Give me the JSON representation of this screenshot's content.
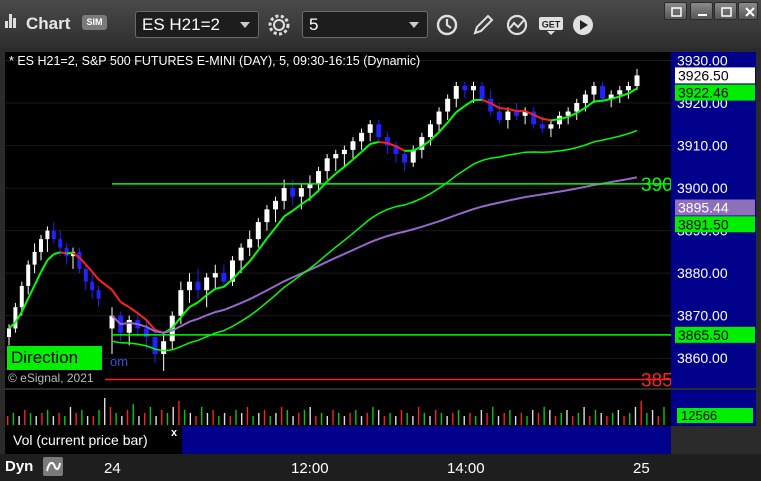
{
  "toolbar": {
    "title": "Chart",
    "sim_badge": "SIM",
    "symbol": "ES H21=2",
    "interval": "5"
  },
  "chart_header": "* ES H21=2, S&P 500 FUTURES E-MINI (DAY), 5, 09:30-16:15 (Dynamic)",
  "annotations": {
    "direction": "Direction",
    "esignal": "© eSignal, 2021",
    "com_fragment": "om",
    "line_3900_label": "390",
    "line_3855_label": "385"
  },
  "volume_panel": {
    "label": "Vol (current price bar)",
    "close": "x",
    "current_value": "12566"
  },
  "time_axis": {
    "dyn_label": "Dyn",
    "ticks": [
      "24",
      "12:00",
      "14:00",
      "25"
    ]
  },
  "colors": {
    "up_candle": "#ffffff",
    "down_candle": "#2222ff",
    "fast_ma": "#00ff00",
    "ma_red": "#ff2020",
    "slow_ma": "#9966cc",
    "level_green": "#00ff00",
    "level_red": "#ff2020",
    "axis_bg": "#00008b"
  },
  "chart_data": {
    "type": "candlestick",
    "title": "* ES H21=2, S&P 500 FUTURES E-MINI (DAY), 5, 09:30-16:15 (Dynamic)",
    "ylim": [
      3853,
      3932
    ],
    "y_ticks": [
      3860,
      3870,
      3880,
      3890,
      3900,
      3910,
      3920,
      3930
    ],
    "y_tick_labels": [
      "3860.00",
      "3870.00",
      "3880.00",
      "3890.00",
      "3900.00",
      "3910.00",
      "3920.00",
      "3930.00"
    ],
    "x_ticks": [
      "24",
      "12:00",
      "14:00",
      "25"
    ],
    "price_badges": [
      {
        "value": 3926.5,
        "label": "3926.50",
        "bg": "#ffffff",
        "fg": "#000000"
      },
      {
        "value": 3922.46,
        "label": "3922.46",
        "bg": "#00ee00",
        "fg": "#000000"
      },
      {
        "value": 3895.44,
        "label": "3895.44",
        "bg": "#8f6fb8",
        "fg": "#ffffff"
      },
      {
        "value": 3891.5,
        "label": "3891.50",
        "bg": "#00ee00",
        "fg": "#000000"
      },
      {
        "value": 3865.5,
        "label": "3865.50",
        "bg": "#00ee00",
        "fg": "#000000"
      }
    ],
    "levels": [
      {
        "value": 3901,
        "color": "#00ff00",
        "label": "390"
      },
      {
        "value": 3865.5,
        "color": "#00ff00",
        "label": ""
      },
      {
        "value": 3855,
        "color": "#ff2020",
        "label": "385"
      }
    ],
    "candles_prior_session": [
      [
        3865,
        3868,
        3863,
        3867
      ],
      [
        3867,
        3873,
        3866,
        3872
      ],
      [
        3872,
        3878,
        3870,
        3877
      ],
      [
        3877,
        3883,
        3875,
        3882
      ],
      [
        3882,
        3887,
        3880,
        3885
      ],
      [
        3885,
        3889,
        3883,
        3888
      ],
      [
        3888,
        3891,
        3885,
        3890
      ],
      [
        3890,
        3892,
        3887,
        3888
      ],
      [
        3888,
        3890,
        3884,
        3886
      ],
      [
        3886,
        3887,
        3882,
        3884
      ],
      [
        3884,
        3886,
        3881,
        3885
      ],
      [
        3885,
        3886,
        3880,
        3881
      ],
      [
        3881,
        3882,
        3876,
        3878
      ],
      [
        3878,
        3880,
        3874,
        3876
      ],
      [
        3876,
        3877,
        3872,
        3874
      ]
    ],
    "candles": [
      [
        3867,
        3872,
        3861,
        3870
      ],
      [
        3870,
        3871,
        3864,
        3866
      ],
      [
        3866,
        3870,
        3863,
        3869
      ],
      [
        3869,
        3871,
        3865,
        3867
      ],
      [
        3867,
        3869,
        3862,
        3865
      ],
      [
        3865,
        3867,
        3859,
        3861
      ],
      [
        3861,
        3866,
        3857,
        3864
      ],
      [
        3864,
        3871,
        3862,
        3870
      ],
      [
        3870,
        3878,
        3868,
        3876
      ],
      [
        3876,
        3880,
        3873,
        3878
      ],
      [
        3878,
        3881,
        3874,
        3876
      ],
      [
        3876,
        3880,
        3872,
        3879
      ],
      [
        3879,
        3882,
        3876,
        3880
      ],
      [
        3880,
        3882,
        3877,
        3878
      ],
      [
        3878,
        3884,
        3877,
        3883
      ],
      [
        3883,
        3887,
        3880,
        3886
      ],
      [
        3886,
        3890,
        3884,
        3888
      ],
      [
        3888,
        3893,
        3886,
        3892
      ],
      [
        3892,
        3896,
        3890,
        3895
      ],
      [
        3895,
        3898,
        3892,
        3897
      ],
      [
        3897,
        3902,
        3895,
        3900
      ],
      [
        3900,
        3902,
        3896,
        3898
      ],
      [
        3898,
        3901,
        3895,
        3900
      ],
      [
        3900,
        3903,
        3897,
        3901
      ],
      [
        3901,
        3905,
        3899,
        3904
      ],
      [
        3904,
        3908,
        3902,
        3907
      ],
      [
        3907,
        3909,
        3904,
        3908
      ],
      [
        3908,
        3910,
        3905,
        3909
      ],
      [
        3909,
        3912,
        3907,
        3911
      ],
      [
        3911,
        3914,
        3909,
        3913
      ],
      [
        3913,
        3916,
        3911,
        3915
      ],
      [
        3915,
        3916,
        3911,
        3912
      ],
      [
        3912,
        3913,
        3908,
        3910
      ],
      [
        3910,
        3911,
        3906,
        3908
      ],
      [
        3908,
        3909,
        3904,
        3906
      ],
      [
        3906,
        3910,
        3905,
        3909
      ],
      [
        3909,
        3913,
        3907,
        3912
      ],
      [
        3912,
        3916,
        3910,
        3915
      ],
      [
        3915,
        3919,
        3913,
        3918
      ],
      [
        3918,
        3922,
        3916,
        3921
      ],
      [
        3921,
        3925,
        3919,
        3924
      ],
      [
        3924,
        3925,
        3921,
        3923
      ],
      [
        3923,
        3925,
        3920,
        3924
      ],
      [
        3924,
        3925,
        3920,
        3921
      ],
      [
        3921,
        3923,
        3917,
        3918
      ],
      [
        3918,
        3920,
        3915,
        3916
      ],
      [
        3916,
        3919,
        3914,
        3918
      ],
      [
        3918,
        3920,
        3916,
        3917
      ],
      [
        3917,
        3919,
        3915,
        3918
      ],
      [
        3918,
        3919,
        3914,
        3915
      ],
      [
        3915,
        3917,
        3913,
        3914
      ],
      [
        3914,
        3916,
        3912,
        3915
      ],
      [
        3915,
        3918,
        3914,
        3917
      ],
      [
        3917,
        3919,
        3915,
        3918
      ],
      [
        3918,
        3921,
        3916,
        3920
      ],
      [
        3920,
        3923,
        3918,
        3922
      ],
      [
        3922,
        3925,
        3920,
        3924
      ],
      [
        3924,
        3925,
        3920,
        3921
      ],
      [
        3921,
        3923,
        3919,
        3922
      ],
      [
        3922,
        3924,
        3920,
        3923
      ],
      [
        3923,
        3925,
        3921,
        3924
      ],
      [
        3924,
        3928,
        3923,
        3926.5
      ]
    ],
    "volume": [
      3,
      4,
      3,
      5,
      4,
      3,
      4,
      5,
      3,
      4,
      3,
      6,
      4,
      5,
      3,
      3,
      5,
      9,
      6,
      4,
      3,
      5,
      7,
      3,
      4,
      6,
      3,
      5,
      4,
      6,
      8,
      5,
      4,
      3,
      6,
      4,
      5,
      3,
      4,
      3,
      5,
      4,
      6,
      3,
      4,
      5,
      3,
      4,
      6,
      5,
      3,
      4,
      5,
      6,
      3,
      4,
      3,
      5,
      4,
      3,
      4,
      5,
      3,
      4,
      6,
      5,
      3,
      4,
      3,
      5,
      4,
      3,
      6,
      4,
      3,
      5,
      4,
      3,
      4,
      5,
      3,
      4,
      3,
      5,
      4,
      6,
      3,
      4,
      5,
      3,
      4,
      3,
      5,
      4,
      6,
      5,
      3,
      4,
      5,
      3,
      4,
      6,
      3,
      5,
      4,
      3,
      4,
      5,
      3,
      4,
      6,
      8,
      4,
      5,
      3,
      6
    ]
  }
}
